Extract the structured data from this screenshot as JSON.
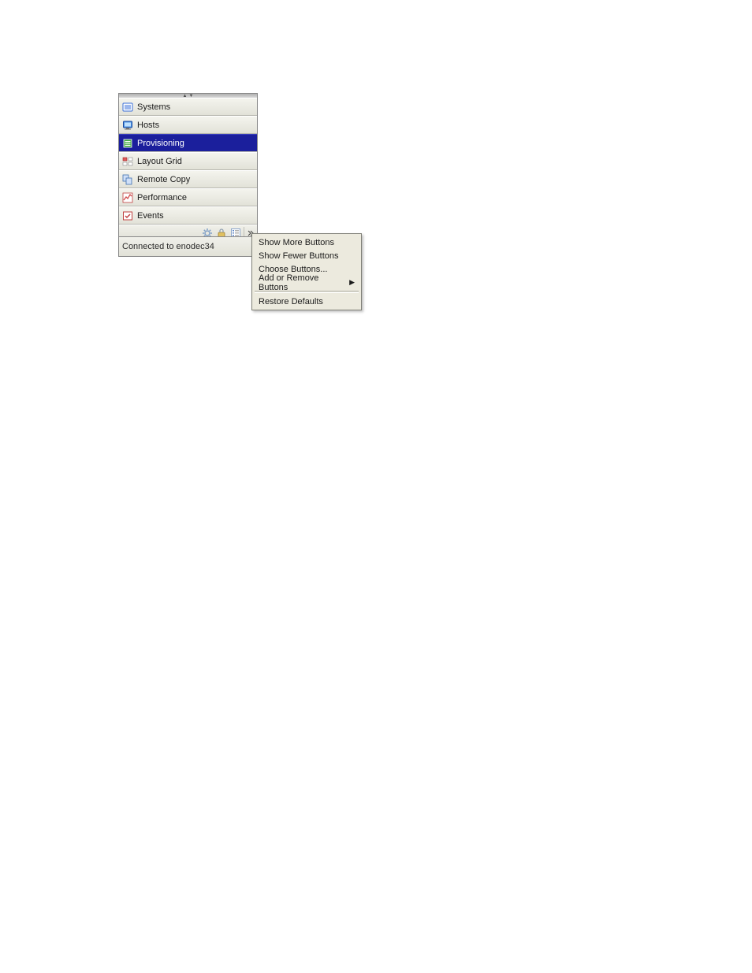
{
  "nav": {
    "items": [
      {
        "label": "Systems",
        "icon": "systems-icon",
        "selected": false
      },
      {
        "label": "Hosts",
        "icon": "hosts-icon",
        "selected": false
      },
      {
        "label": "Provisioning",
        "icon": "provisioning-icon",
        "selected": true
      },
      {
        "label": "Layout Grid",
        "icon": "layout-grid-icon",
        "selected": false
      },
      {
        "label": "Remote Copy",
        "icon": "remote-copy-icon",
        "selected": false
      },
      {
        "label": "Performance",
        "icon": "performance-icon",
        "selected": false
      },
      {
        "label": "Events",
        "icon": "events-icon",
        "selected": false
      }
    ],
    "toolbar": {
      "icons": [
        "gear-icon",
        "lock-icon",
        "list-icon"
      ]
    }
  },
  "status": {
    "text": "Connected to enodec34"
  },
  "context_menu": {
    "items": [
      {
        "label": "Show More Buttons",
        "submenu": false
      },
      {
        "label": "Show Fewer Buttons",
        "submenu": false
      },
      {
        "label": "Choose Buttons...",
        "submenu": false
      },
      {
        "label": "Add or Remove Buttons",
        "submenu": true
      }
    ],
    "footer_items": [
      {
        "label": "Restore Defaults",
        "submenu": false
      }
    ]
  }
}
